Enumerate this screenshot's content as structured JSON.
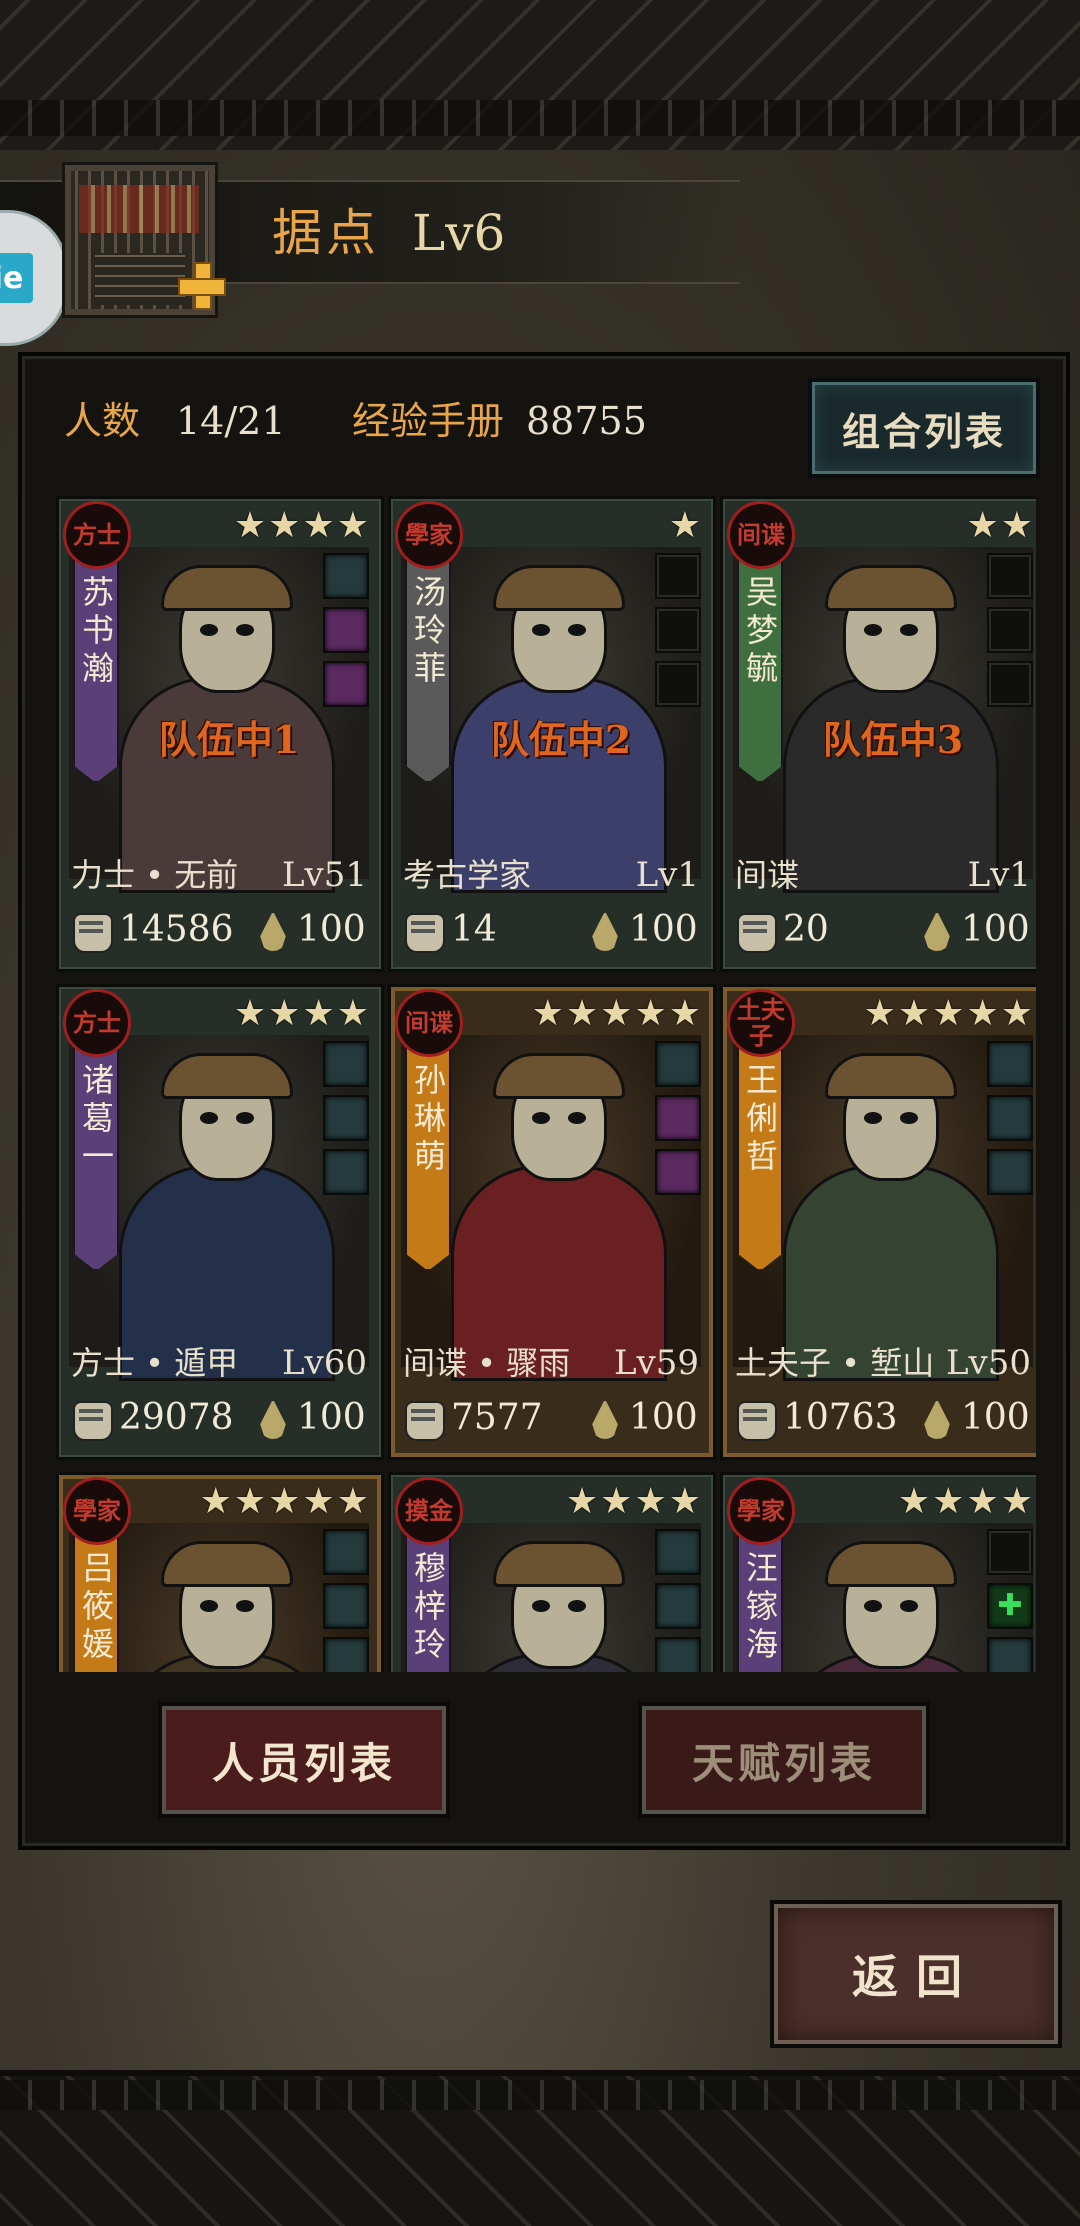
{
  "header": {
    "title": "据点",
    "level": "Lv6",
    "side_badge": "ie"
  },
  "stats": {
    "headcount_label": "人数",
    "headcount_value": "14/21",
    "exp_label": "经验手册",
    "exp_value": "88755"
  },
  "buttons": {
    "combo_list": "组合列表",
    "personnel_tab": "人员列表",
    "talent_tab": "天赋列表",
    "back": "返回"
  },
  "characters": [
    {
      "seal": "方士",
      "name": "苏书瀚",
      "stars": "★★★★",
      "team": "队伍中1",
      "class": "力士 • 无前",
      "level": "Lv51",
      "power": "14586",
      "stamina": "100",
      "banner": "purple"
    },
    {
      "seal": "學家",
      "name": "汤玲菲",
      "stars": "★",
      "team": "队伍中2",
      "class": "考古学家",
      "level": "Lv1",
      "power": "14",
      "stamina": "100",
      "banner": "grey"
    },
    {
      "seal": "间谍",
      "name": "吴梦毓",
      "stars": "★★",
      "team": "队伍中3",
      "class": "间谍",
      "level": "Lv1",
      "power": "20",
      "stamina": "100",
      "banner": "green"
    },
    {
      "seal": "方士",
      "name": "诸葛一",
      "stars": "★★★★",
      "team": "",
      "class": "方士 • 遁甲",
      "level": "Lv60",
      "power": "29078",
      "stamina": "100",
      "banner": "purple"
    },
    {
      "seal": "间谍",
      "name": "孙琳萌",
      "stars": "★★★★★",
      "team": "",
      "class": "间谍 • 骤雨",
      "level": "Lv59",
      "power": "7577",
      "stamina": "100",
      "banner": "orange"
    },
    {
      "seal": "土夫子",
      "name": "王俐哲",
      "stars": "★★★★★",
      "team": "",
      "class": "土夫子 • 堑山",
      "level": "Lv50",
      "power": "10763",
      "stamina": "100",
      "banner": "orange"
    },
    {
      "seal": "學家",
      "name": "吕筱媛",
      "stars": "★★★★★",
      "team": "",
      "class": "",
      "level": "",
      "power": "",
      "stamina": "",
      "banner": "orange"
    },
    {
      "seal": "摸金",
      "name": "穆梓玲",
      "stars": "★★★★",
      "team": "",
      "class": "",
      "level": "",
      "power": "",
      "stamina": "",
      "banner": "purple"
    },
    {
      "seal": "學家",
      "name": "汪镓海",
      "stars": "★★★★",
      "team": "",
      "class": "",
      "level": "",
      "power": "",
      "stamina": "",
      "banner": "purple"
    }
  ]
}
